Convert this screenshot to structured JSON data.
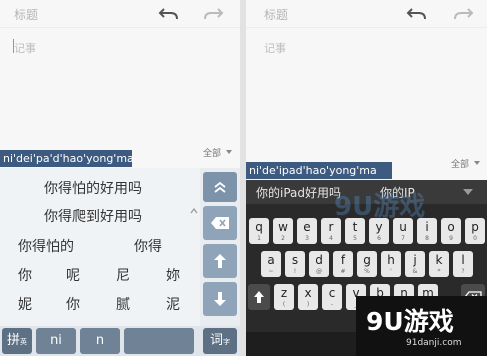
{
  "left": {
    "title_placeholder": "标题",
    "note_placeholder": "记事",
    "all_label": "全部",
    "pinyin": "ni'dei'pa'd'hao'yong'ma",
    "candidates": [
      "你得怕的好用吗",
      "你得爬到好用吗",
      "你得怕的",
      "你得"
    ],
    "single_chars": [
      "你",
      "呢",
      "尼",
      "妳",
      "妮",
      "你",
      "腻",
      "泥"
    ],
    "bottom": {
      "mode_label": "拼",
      "mode_sub": "英",
      "syllable_1": "ni",
      "syllable_2": "n",
      "phrase_label": "词",
      "phrase_sub": "字"
    },
    "icons": {
      "undo": "undo-icon",
      "redo": "redo-icon",
      "expand": "expand-icon",
      "delete": "backspace-icon",
      "up": "arrow-up-icon",
      "down": "arrow-down-icon"
    }
  },
  "right": {
    "title_placeholder": "标题",
    "note_placeholder": "记事",
    "all_label": "全部",
    "pinyin": "ni'de'ipad'hao'yong'ma",
    "candidates": [
      "你的iPad好用吗",
      "你的IP"
    ],
    "rows": {
      "row1": [
        "q",
        "w",
        "e",
        "r",
        "t",
        "y",
        "u",
        "i",
        "o",
        "p"
      ],
      "row1_sub": [
        "1",
        "2",
        "3",
        "4",
        "5",
        "6",
        "7",
        "8",
        "9",
        "0"
      ],
      "row2": [
        "a",
        "s",
        "d",
        "f",
        "g",
        "h",
        "j",
        "k",
        "l"
      ],
      "row2_sub": [
        "~",
        "!",
        "@",
        "#",
        "%",
        "'",
        "&",
        "*",
        "?"
      ],
      "row3": [
        "z",
        "x",
        "c",
        "v",
        "b",
        "n",
        "m"
      ],
      "row3_sub": [
        "(",
        ")",
        "-",
        "_",
        ":",
        ";",
        "/"
      ]
    },
    "icons": {
      "shift": "shift-icon",
      "delete": "backspace-icon",
      "collapse": "caret-down-icon"
    }
  },
  "watermark": {
    "logo": "9U游戏",
    "site": "91danji.com",
    "center_text": "9U游戏"
  },
  "colors": {
    "pinyin_bar": "#3d5a80",
    "left_side_keys": "#8fa4b8",
    "cursor": "#7ab34a"
  }
}
